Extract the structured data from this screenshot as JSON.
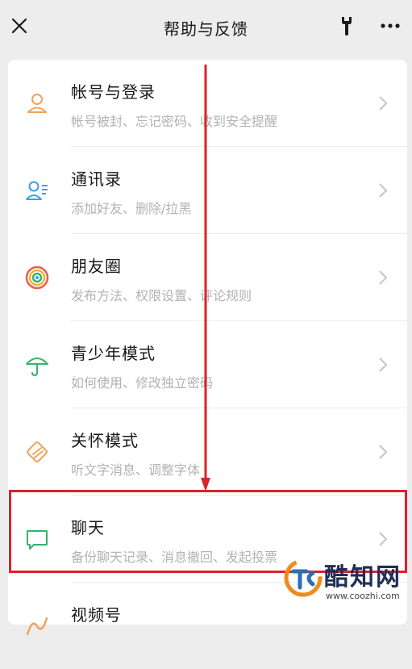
{
  "header": {
    "title": "帮助与反馈"
  },
  "items": [
    {
      "title": "帐号与登录",
      "subtitle": "帐号被封、忘记密码、收到安全提醒",
      "icon": "user-icon",
      "color": "#f0a35c"
    },
    {
      "title": "通讯录",
      "subtitle": "添加好友、删除/拉黑",
      "icon": "contacts-icon",
      "color": "#3aa1e0"
    },
    {
      "title": "朋友圈",
      "subtitle": "发布方法、权限设置、评论规则",
      "icon": "moments-icon",
      "color": "#e8604c"
    },
    {
      "title": "青少年模式",
      "subtitle": "如何使用、修改独立密码",
      "icon": "umbrella-icon",
      "color": "#35b36b"
    },
    {
      "title": "关怀模式",
      "subtitle": "听文字消息、调整字体",
      "icon": "care-icon",
      "color": "#f0a35c"
    },
    {
      "title": "聊天",
      "subtitle": "备份聊天记录、消息撤回、发起投票",
      "icon": "chat-icon",
      "color": "#35b36b"
    },
    {
      "title": "视频号",
      "subtitle": "",
      "icon": "video-icon",
      "color": "#f0a35c"
    }
  ],
  "watermark": {
    "brand": "酷知网",
    "url": "www.coozhi.com"
  },
  "annotation_color": "#d9232a"
}
